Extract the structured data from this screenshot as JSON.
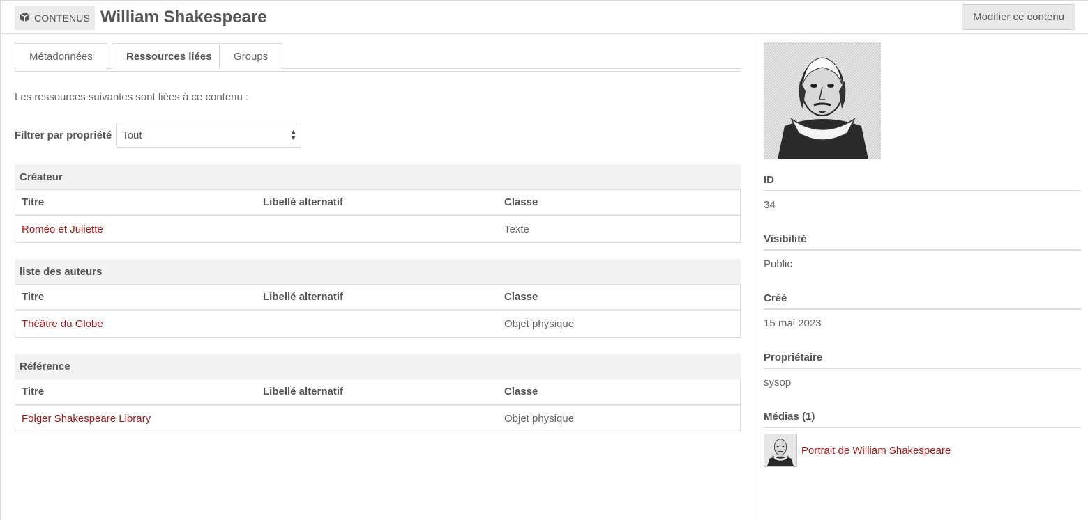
{
  "header": {
    "section_label": "CONTENUS",
    "title": "William Shakespeare",
    "edit_button": "Modifier ce contenu"
  },
  "tabs": [
    {
      "label": "Métadonnées",
      "active": false
    },
    {
      "label": "Ressources liées",
      "active": true
    },
    {
      "label": "Groups",
      "active": false
    }
  ],
  "intro": "Les ressources suivantes sont liées à ce contenu :",
  "filter": {
    "label": "Filtrer par propriété",
    "selected": "Tout"
  },
  "columns": {
    "title": "Titre",
    "alt_label": "Libellé alternatif",
    "class": "Classe"
  },
  "groups": [
    {
      "title": "Créateur",
      "rows": [
        {
          "title": "Roméo et Juliette",
          "alt": "",
          "class": "Texte"
        }
      ]
    },
    {
      "title": "liste des auteurs",
      "rows": [
        {
          "title": "Théâtre du Globe",
          "alt": "",
          "class": "Objet physique"
        }
      ]
    },
    {
      "title": "Référence",
      "rows": [
        {
          "title": "Folger Shakespeare Library",
          "alt": "",
          "class": "Objet physique"
        }
      ]
    }
  ],
  "sidebar": {
    "id_label": "ID",
    "id_value": "34",
    "visibility_label": "Visibilité",
    "visibility_value": "Public",
    "created_label": "Créé",
    "created_value": "15 mai 2023",
    "owner_label": "Propriétaire",
    "owner_value": "sysop",
    "media_label": "Médias (1)",
    "media_item": "Portrait de William Shakespeare"
  },
  "colors": {
    "link": "#a91919",
    "text": "#666666",
    "heading": "#555555"
  }
}
